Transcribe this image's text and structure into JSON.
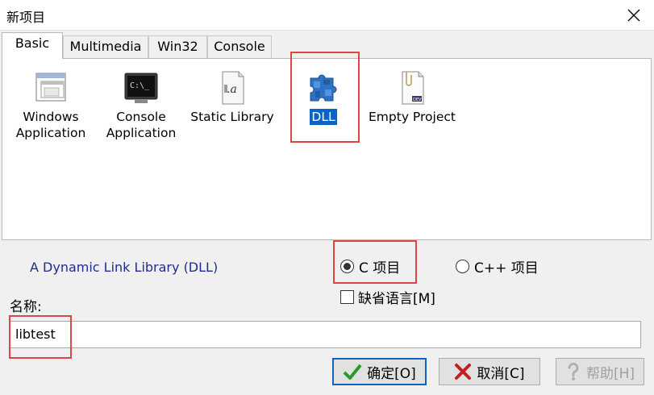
{
  "window": {
    "title": "新项目"
  },
  "tabs": [
    {
      "label": "Basic"
    },
    {
      "label": "Multimedia"
    },
    {
      "label": "Win32"
    },
    {
      "label": "Console"
    }
  ],
  "projects": [
    {
      "label_line1": "Windows",
      "label_line2": "Application",
      "icon": "windows-app-icon"
    },
    {
      "label_line1": "Console",
      "label_line2": "Application",
      "icon": "console-app-icon"
    },
    {
      "label_line1": "Static Library",
      "label_line2": "",
      "icon": "static-library-icon"
    },
    {
      "label_line1": "DLL",
      "label_line2": "",
      "icon": "dll-icon",
      "selected": true
    },
    {
      "label_line1": "Empty Project",
      "label_line2": "",
      "icon": "empty-project-icon"
    }
  ],
  "description": "A Dynamic Link Library (DLL)",
  "language": {
    "c_label": "C 项目",
    "cpp_label": "C++ 项目",
    "selected": "C"
  },
  "default_language_label": "缺省语言[M]",
  "name": {
    "label": "名称:",
    "value": "libtest"
  },
  "buttons": {
    "ok": "确定[O]",
    "cancel": "取消[C]",
    "help": "帮助[H]"
  },
  "colors": {
    "accent": "#0a64c8",
    "highlight_box": "#e04545",
    "description_text": "#1e2d8f"
  }
}
